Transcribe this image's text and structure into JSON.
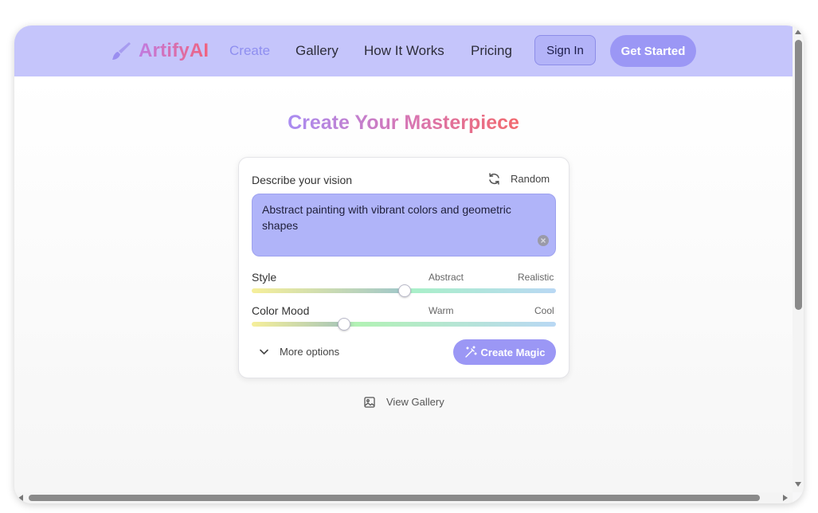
{
  "header": {
    "brand": "ArtifyAI",
    "nav": {
      "create": "Create",
      "gallery": "Gallery",
      "how_it_works": "How It Works",
      "pricing": "Pricing"
    },
    "sign_in": "Sign In",
    "get_started": "Get Started"
  },
  "main": {
    "title": "Create Your Masterpiece",
    "card": {
      "vision_label": "Describe your vision",
      "random_label": "Random",
      "prompt_value": "Abstract painting with vibrant colors and geometric shapes",
      "style": {
        "label": "Style",
        "left_hint": "Abstract",
        "right_hint": "Realistic",
        "value": 0.5
      },
      "color_mood": {
        "label": "Color Mood",
        "left_hint": "Warm",
        "right_hint": "Cool",
        "value": 0.3
      },
      "more_options": "More options",
      "create_button": "Create Magic"
    },
    "view_gallery": "View Gallery"
  },
  "colors": {
    "header_bg": "#c5c5fb",
    "accent": "#9b97f5",
    "prompt_bg": "#b0b4f9",
    "brand_gradient_start": "#c07be0",
    "brand_gradient_end": "#f0637e"
  },
  "icons": {
    "logo": "paintbrush-icon",
    "random": "refresh-icon",
    "clear": "clear-icon",
    "more_options": "chevron-down-icon",
    "create": "magic-wand-icon",
    "gallery": "image-icon"
  }
}
